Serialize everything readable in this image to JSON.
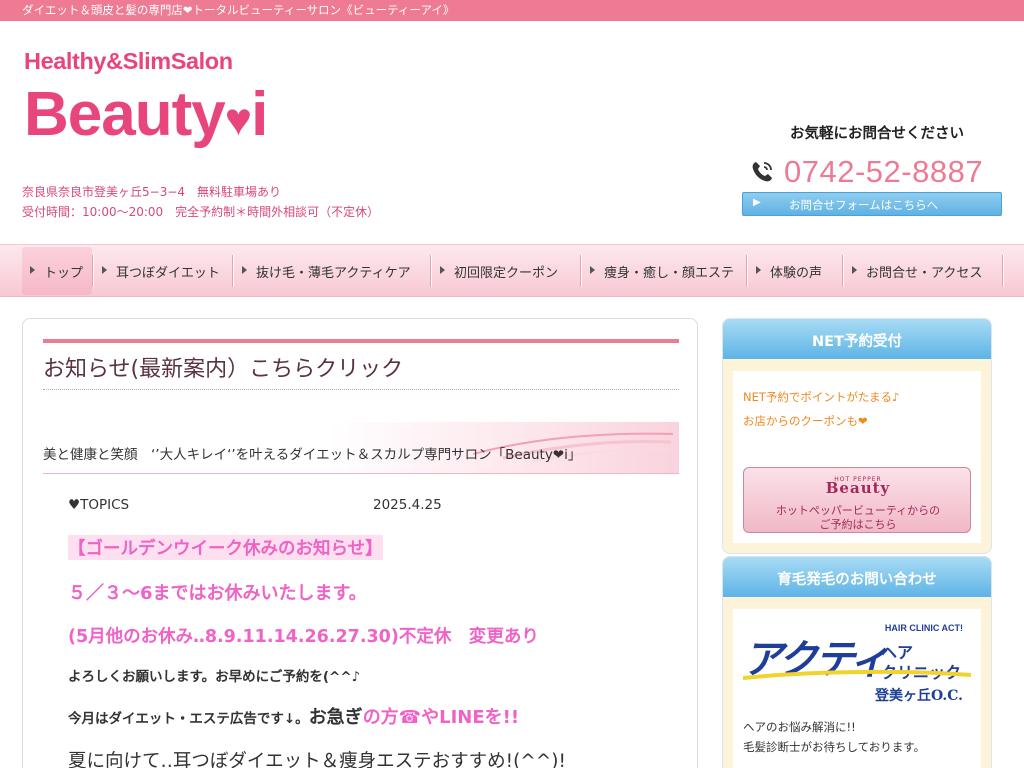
{
  "topbar": {
    "text": "ダイエット＆頭皮と髪の専門店❤トータルビューティーサロン《ビューティーアイ》"
  },
  "logo": {
    "subtitle": "Healthy&SlimSalon",
    "name": "Beauty",
    "heart": "♥",
    "letter": "i"
  },
  "info": {
    "address": "奈良県奈良市登美ヶ丘5−3−4　無料駐車場あり",
    "hours": "受付時間：10:00〜20:00　完全予約制＊時間外相談可（不定休）"
  },
  "contact": {
    "heading": "お気軽にお問合せください",
    "phone": "0742-52-8887",
    "form_arrow": "▶",
    "form_label": "お問合せフォームはこちらへ"
  },
  "nav": {
    "items": [
      {
        "label": "トップ",
        "active": true
      },
      {
        "label": "耳つぼダイエット",
        "active": false
      },
      {
        "label": "抜け毛・薄毛アクティケア",
        "active": false
      },
      {
        "label": "初回限定クーポン",
        "active": false
      },
      {
        "label": "痩身・癒し・顔エステ",
        "active": false
      },
      {
        "label": "体験の声",
        "active": false
      },
      {
        "label": "お問合せ・アクセス",
        "active": false
      }
    ]
  },
  "main": {
    "title": "お知らせ(最新案内）こちらクリック",
    "banner": "美と健康と笑顔　‘’大人キレイ‘’を叶えるダイエット＆スカルプ専門サロン「Beauty❤i」",
    "topics_label": "♥TOPICS",
    "topics_date": "2025.4.25",
    "notice_title": "【ゴールデンウイーク休みのお知らせ】",
    "notice_line1": "５／３〜6まではお休みいたします。",
    "notice_line2": "(5月他のお休み‥8.9.11.14.26.27.30)不定休　変更あり",
    "notice_line3": "よろしくお願いします。お早めにご予約を(^^♪",
    "notice_line4_a": "今月はダイエット・エステ広告です↓。",
    "notice_line4_b": "お急ぎ",
    "notice_line4_c": "の方☎やLINEを!!",
    "notice_line5": "夏に向けて‥耳つぼダイエット＆痩身エステおすすめ!(^^)!"
  },
  "sidebar": {
    "net": {
      "heading": "NET予約受付",
      "line1": "NET予約でポイントがたまる♪",
      "line2": "お店からのクーポンも❤",
      "hp_small": "HOT PEPPER",
      "hp_brand": "Beauty",
      "hp_line1": "ホットペッパービューティからの",
      "hp_line2": "ご予約はこちら"
    },
    "hair": {
      "heading": "育毛発毛のお問い合わせ",
      "logo_en": "HAIR CLINIC ACT!",
      "logo_main": "アクティ",
      "logo_sub1": "ヘア",
      "logo_sub2": "クリニック",
      "logo_loc": "登美ヶ丘O.C.",
      "line1": "ヘアのお悩み解消に!!",
      "line2": "毛髪診断士がお待ちしております。"
    }
  },
  "colors": {
    "pink": "#ef7a93",
    "magenta": "#ef63c7",
    "blue": "#5db4e6",
    "navy": "#1f3e9a"
  }
}
